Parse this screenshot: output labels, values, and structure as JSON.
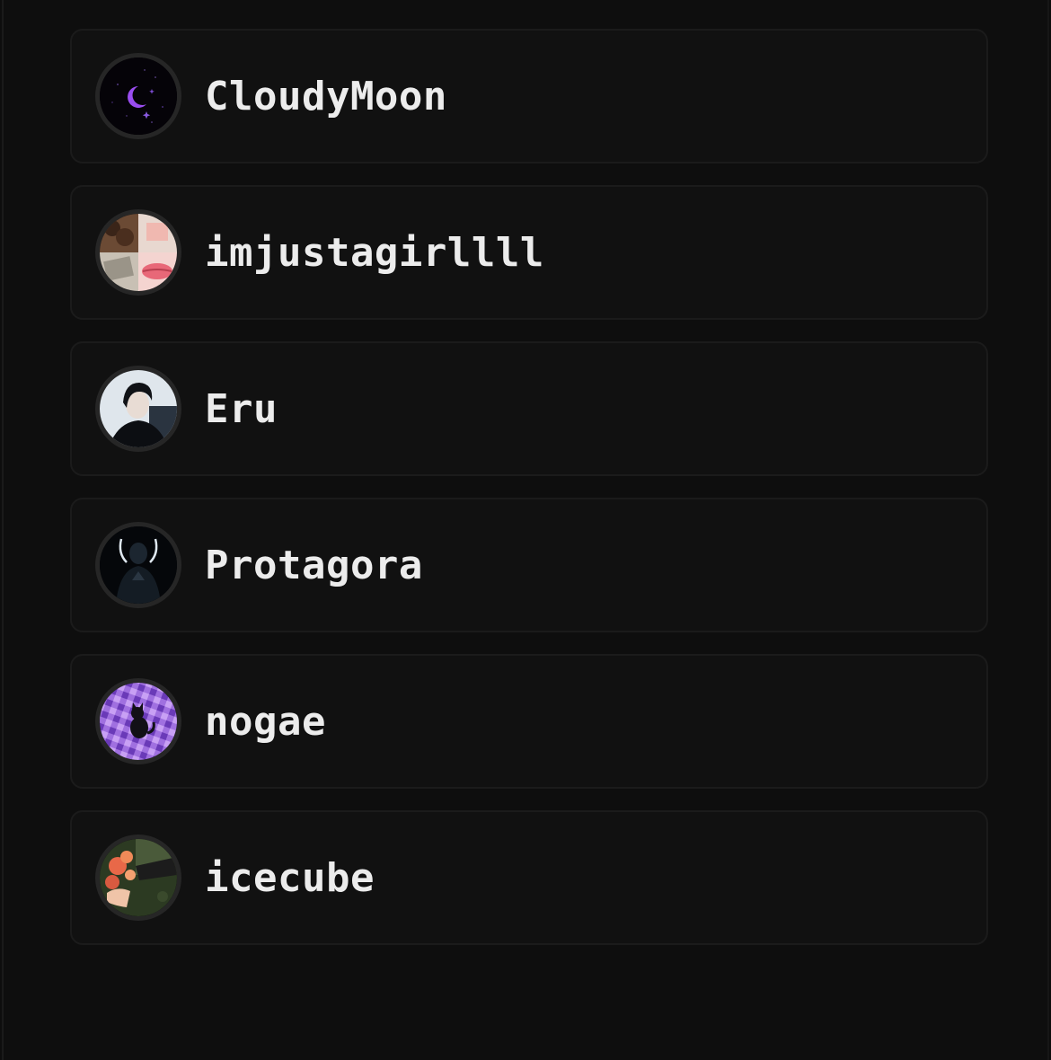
{
  "users": [
    {
      "name": "CloudyMoon",
      "avatar_icon": "crescent-moon-avatar"
    },
    {
      "name": "imjustagirllll",
      "avatar_icon": "collage-avatar"
    },
    {
      "name": "Eru",
      "avatar_icon": "portrait-avatar"
    },
    {
      "name": "Protagora",
      "avatar_icon": "dark-figure-avatar"
    },
    {
      "name": "nogae",
      "avatar_icon": "purple-cat-avatar"
    },
    {
      "name": "icecube",
      "avatar_icon": "flowers-avatar"
    }
  ]
}
